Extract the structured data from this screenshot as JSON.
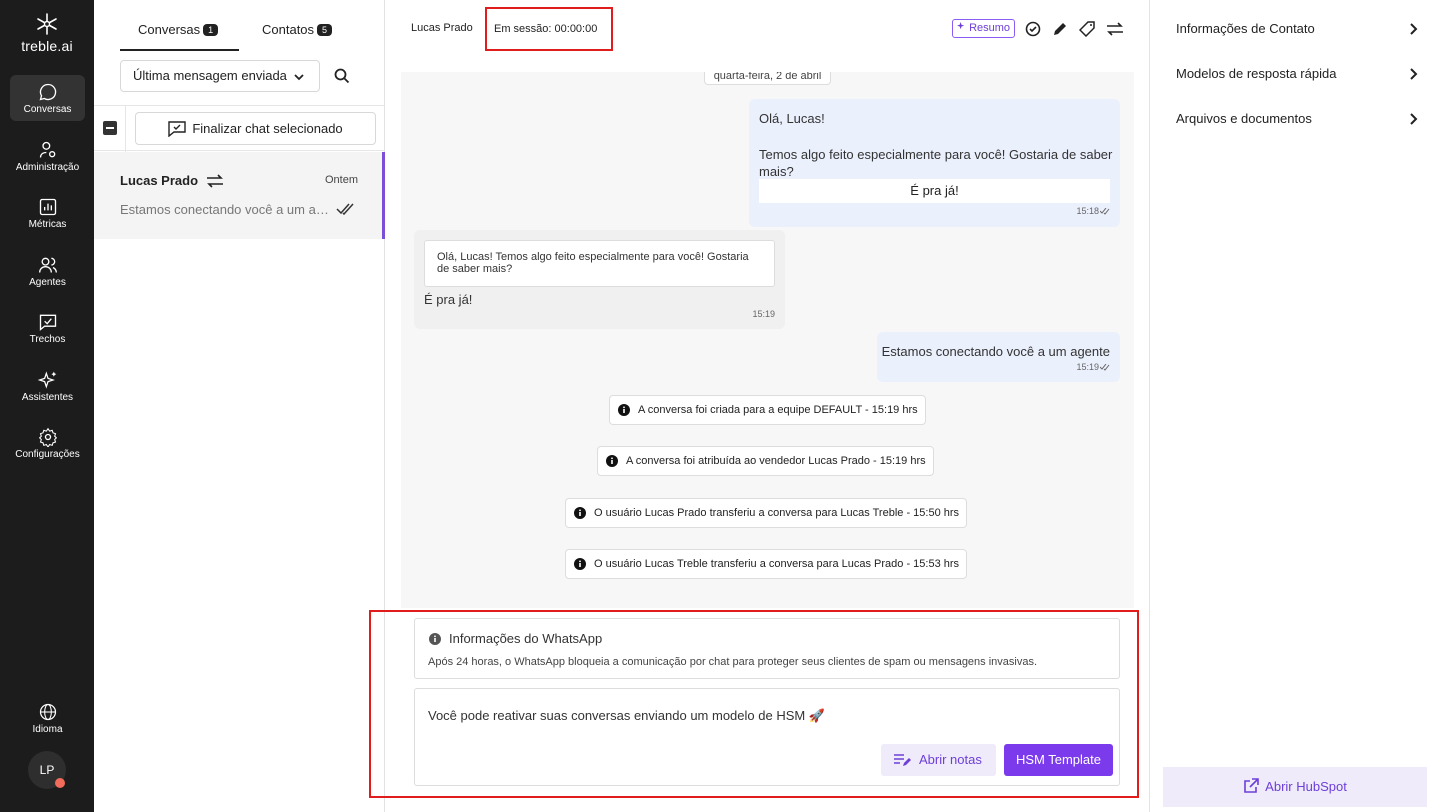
{
  "brand": {
    "name": "treble.ai"
  },
  "nav": {
    "items": [
      {
        "label": "Conversas",
        "icon": "chat-bubble-icon"
      },
      {
        "label": "Administração",
        "icon": "admin-user-icon"
      },
      {
        "label": "Métricas",
        "icon": "metrics-chart-icon"
      },
      {
        "label": "Agentes",
        "icon": "agents-icon"
      },
      {
        "label": "Trechos",
        "icon": "snippets-icon"
      },
      {
        "label": "Assistentes",
        "icon": "sparkles-icon"
      },
      {
        "label": "Configurações",
        "icon": "gear-icon"
      }
    ],
    "language_label": "Idioma",
    "avatar_initials": "LP"
  },
  "list": {
    "tabs": [
      {
        "label": "Conversas",
        "count": "1"
      },
      {
        "label": "Contatos",
        "count": "5"
      }
    ],
    "sort_label": "Última mensagem enviada",
    "finalize_label": "Finalizar chat selecionado",
    "conversation": {
      "name": "Lucas Prado",
      "time": "Ontem",
      "preview": "Estamos conectando você a um agente"
    }
  },
  "chat": {
    "contact_name": "Lucas Prado",
    "session": "Em sessão: 00:00:00",
    "summary_label": "Resumo",
    "date_chip": "quarta-feira, 2 de abril",
    "messages": {
      "m1": {
        "greeting": "Olá, Lucas!",
        "body": "Temos algo feito especialmente para você! Gostaria de saber mais?",
        "button": "É pra já!",
        "time": "15:18"
      },
      "m2": {
        "quote": "Olá, Lucas! Temos algo feito especialmente para você! Gostaria de saber mais?",
        "text": "É pra já!",
        "time": "15:19"
      },
      "m3": {
        "text": "Estamos conectando você a um agente",
        "time": "15:19"
      }
    },
    "system": [
      "A conversa foi criada para a equipe DEFAULT - 15:19 hrs",
      "A conversa foi atribuída ao vendedor Lucas Prado - 15:19 hrs",
      "O usuário Lucas Prado transferiu a conversa para Lucas Treble - 15:50 hrs",
      "O usuário Lucas Treble transferiu a conversa para Lucas Prado - 15:53 hrs"
    ],
    "whatsapp_info": {
      "title": "Informações do WhatsApp",
      "text": "Após 24 horas, o WhatsApp bloqueia a comunicação por chat para proteger seus clientes de spam ou mensagens invasivas."
    },
    "composer": {
      "text": "Você pode reativar suas conversas enviando um modelo de HSM 🚀",
      "notes_label": "Abrir notas",
      "hsm_label": "HSM Template"
    }
  },
  "side": {
    "items": [
      "Informações de Contato",
      "Modelos de resposta rápida",
      "Arquivos e documentos"
    ],
    "hubspot_label": "Abrir HubSpot"
  },
  "colors": {
    "accent": "#7c3aed",
    "highlight": "#e01c1c",
    "nav_bg": "#1c1c1c"
  }
}
